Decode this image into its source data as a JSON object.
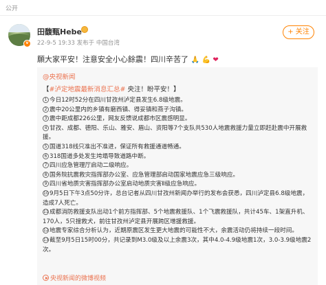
{
  "header": {
    "visibility": "公开"
  },
  "author": {
    "name": "田馥甄Hebe",
    "meta": "22-9-5 19:33  发布于 中国台湾",
    "avatar_icon": "landscape-avatar",
    "verified_icon": "verified-badge-icon",
    "medal_icon": "medal-icon"
  },
  "follow": {
    "label": "+ 关注"
  },
  "post": {
    "text": "願大家平安！注意安全小心餘震！四川辛苦了",
    "emojis": [
      "🙏",
      "💪",
      "❤"
    ]
  },
  "repost": {
    "author": "@央视新闻",
    "topic": "#泸定地震最新消息汇总#",
    "topic_rest": " 央注！盼平安！】",
    "prefix": "【",
    "lines": [
      {
        "n": "1",
        "text": "今日12时52分在四川甘孜州泸定县发生6.8级地震。"
      },
      {
        "n": "2",
        "text": "震中20公里内的乡镇有磨西镇、得妥镇和燕子沟镇。"
      },
      {
        "n": "3",
        "text": "震中距成都226公里，网友反馈说成都市区震感明显。"
      },
      {
        "n": "4",
        "text": "甘孜、成都、德阳、乐山、雅安、眉山、资阳等7个支队共530人地震救援力量立即赶赴震中开展救"
      },
      {
        "n": "",
        "text": "援。"
      },
      {
        "n": "5",
        "text": "国道318线只准出不准进，保证所有救援通道畅通。"
      },
      {
        "n": "6",
        "text": "318国道多处发生垮塌导致道路中断。"
      },
      {
        "n": "7",
        "text": "四川应急管理厅启动二级响应。"
      },
      {
        "n": "8",
        "text": "国务院抗震救灾指挥部办公室、应急管理部启动国家地震应急三级响应。"
      },
      {
        "n": "9",
        "text": "四川省地质灾害指挥部办公室启动地质灾害Ⅱ级应急响应。"
      },
      {
        "n": "10",
        "text": "9月5日下午3点50分许，总台记者从四川甘孜州新闻办举行的发布会获悉，四川泸定县6.8级地震，"
      },
      {
        "n": "",
        "text": "造成7人死亡。"
      },
      {
        "n": "11",
        "text": "成都消防救援支队出动1个前方指挥部、5个地震救援队、1个飞震救援队，共计45车、1架直升机、"
      },
      {
        "n": "",
        "text": "170人，5只搜救犬，前往甘孜州泸定县开展跨区增援救援。"
      },
      {
        "n": "12",
        "text": "地震专家综合分析认为，近期原震区发生更大地震的可能性不大，余震活动仍将持续一段时间。"
      },
      {
        "n": "13",
        "text": "截至9月5日15时00分，共记录到M3.0级及以上余震3次，其中4.0-4.9级地震1次，3.0-3.9级地震2"
      },
      {
        "n": "",
        "text": "次。"
      }
    ],
    "video_link": "央视新闻的微博视频"
  },
  "colors": {
    "accent": "#ff8200",
    "link": "#eb7350",
    "repost_bg": "#f7f7f7"
  }
}
